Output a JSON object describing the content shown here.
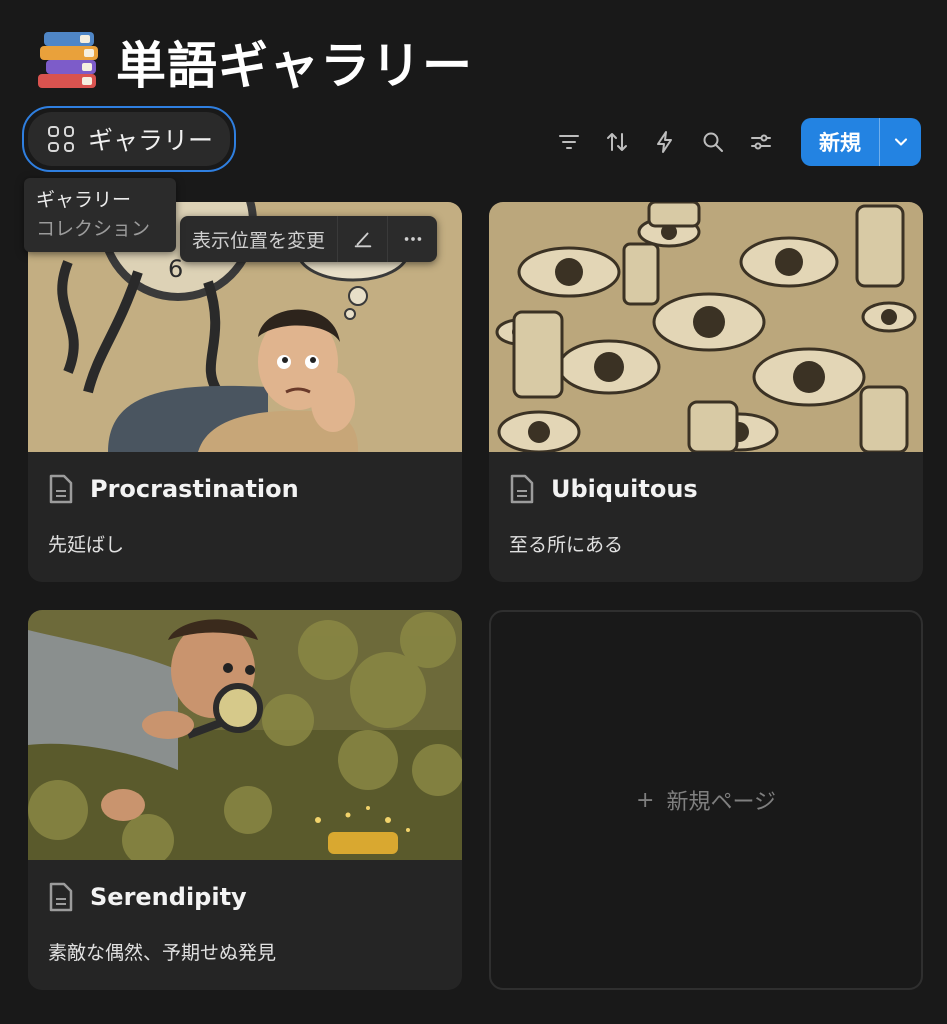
{
  "header": {
    "title": "単語ギャラリー",
    "icon": "books-icon"
  },
  "view_tab": {
    "label": "ギャラリー",
    "icon": "gallery-grid-icon",
    "active": true
  },
  "tooltip": {
    "line1": "ギャラリー",
    "line2": "コレクション"
  },
  "toolbar": {
    "icons": [
      "filter-icon",
      "sort-icon",
      "automation-icon",
      "search-icon",
      "settings-icon"
    ],
    "new_label": "新規",
    "new_dropdown_icon": "chevron-down-icon",
    "accent_color": "#2383e2"
  },
  "card_actions": {
    "move_label": "表示位置を変更",
    "edit_icon": "edit-icon",
    "more_icon": "more-icon"
  },
  "cards": [
    {
      "title": "Procrastination",
      "subtitle": "先延ばし",
      "image": "anxious man with clock illustration"
    },
    {
      "title": "Ubiquitous",
      "subtitle": "至る所にある",
      "image": "eyes and phones pattern illustration"
    },
    {
      "title": "Serendipity",
      "subtitle": "素敵な偶然、予期せぬ発見",
      "image": "man with magnifying glass illustration"
    }
  ],
  "new_page": {
    "label": "新規ページ"
  }
}
